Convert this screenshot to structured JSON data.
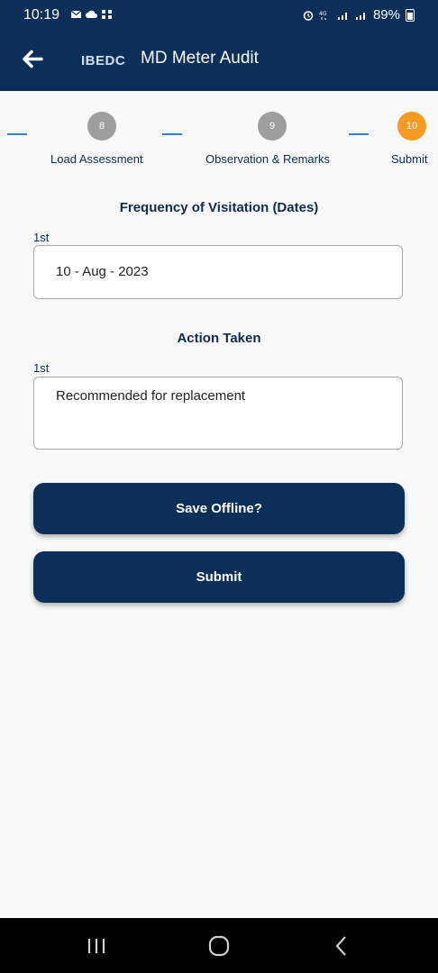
{
  "status_bar": {
    "time": "10:19",
    "battery": "89%",
    "icons_left": [
      "mail-icon",
      "cloud-icon",
      "apps-icon"
    ],
    "icons_right": [
      "alarm-icon",
      "network-4g-icon",
      "signal-icon",
      "signal-icon",
      "battery-icon"
    ]
  },
  "app_bar": {
    "brand": "IBEDC",
    "title": "MD Meter Audit",
    "back_icon": "arrow-left-icon"
  },
  "stepper": {
    "steps": [
      {
        "number": "8",
        "label": "Load Assessment",
        "state": "done"
      },
      {
        "number": "9",
        "label": "Observation & Remarks",
        "state": "done"
      },
      {
        "number": "10",
        "label": "Submit",
        "state": "active"
      }
    ]
  },
  "form": {
    "frequency": {
      "title": "Frequency of Visitation (Dates)",
      "label": "1st",
      "value": "10 - Aug - 2023"
    },
    "action": {
      "title": "Action Taken",
      "label": "1st",
      "value": "Recommended for replacement"
    }
  },
  "buttons": {
    "save_offline": "Save Offline?",
    "submit": "Submit"
  },
  "colors": {
    "primary": "#0c2f5a",
    "active_step": "#f59a23",
    "done_step": "#9e9e9e",
    "step_line": "#2f80d8",
    "background": "#f9f9f9"
  },
  "nav_bar": {
    "icons": [
      "recent-apps-icon",
      "home-icon",
      "back-icon"
    ]
  }
}
